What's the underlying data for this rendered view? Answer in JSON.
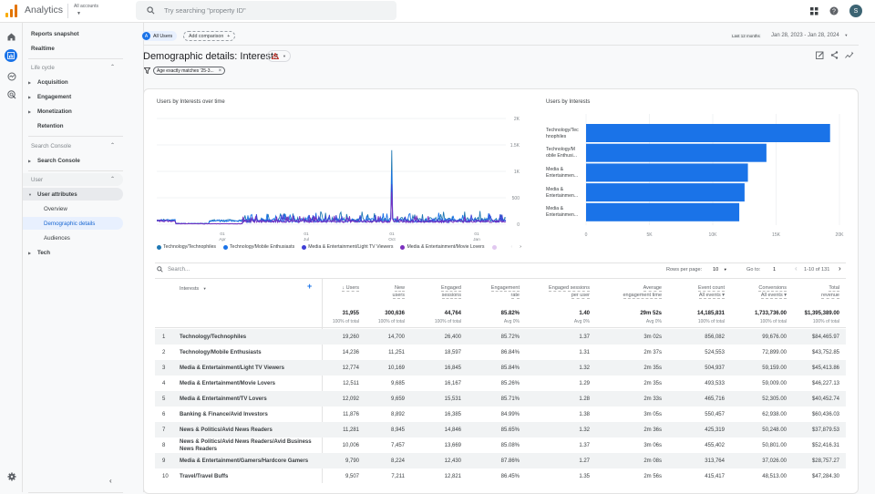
{
  "app": {
    "title": "Analytics",
    "accounts_label": "All accounts",
    "search_placeholder": "Try searching \"property ID\"",
    "avatar_initial": "S"
  },
  "nav": {
    "items": [
      {
        "label": "Reports snapshot",
        "type": "link"
      },
      {
        "label": "Realtime",
        "type": "link"
      },
      {
        "label": "Life cycle",
        "type": "section"
      },
      {
        "label": "Acquisition",
        "type": "group"
      },
      {
        "label": "Engagement",
        "type": "group"
      },
      {
        "label": "Monetization",
        "type": "group"
      },
      {
        "label": "Retention",
        "type": "link"
      },
      {
        "label": "Search Console",
        "type": "section"
      },
      {
        "label": "Search Console",
        "type": "group"
      },
      {
        "label": "User",
        "type": "section"
      },
      {
        "label": "User attributes",
        "type": "group-open"
      },
      {
        "label": "Overview",
        "type": "sub"
      },
      {
        "label": "Demographic details",
        "type": "sub-selected"
      },
      {
        "label": "Audiences",
        "type": "sub"
      },
      {
        "label": "Tech",
        "type": "group"
      }
    ]
  },
  "header": {
    "segment_letter": "A",
    "segment": "All Users",
    "add_comparison": "Add comparison",
    "date_label": "Last 12 months",
    "date_range": "Jan 28, 2023 - Jan 28, 2024",
    "title": "Demographic details: Interests",
    "filter": "Age exactly matches '25-3..."
  },
  "chart_data": [
    {
      "type": "line",
      "title": "Users by Interests over time",
      "x_ticks": [
        "01 Apr",
        "01 Jul",
        "01 Oct",
        "01 Jan"
      ],
      "y_ticks": [
        "0",
        "500",
        "1K",
        "1.5K",
        "2K"
      ],
      "ylim": [
        0,
        2000
      ],
      "series": [
        {
          "name": "Technology/Technophiles",
          "color": "#1f78b4",
          "peak": 1400
        },
        {
          "name": "Technology/Mobile Enthusiasts",
          "color": "#1a73e8",
          "peak": 1100
        },
        {
          "name": "Media & Entertainment/Light TV Viewers",
          "color": "#3f3fd6",
          "peak": 900
        },
        {
          "name": "Media & Entertainment/Movie Lovers",
          "color": "#7b2fbe",
          "peak": 800
        }
      ]
    },
    {
      "type": "bar",
      "title": "Users by Interests",
      "categories": [
        "Technology/Technophiles",
        "Technology/Mobile Enthusiasts",
        "Media & Entertainment/Light TV Viewers",
        "Media & Entertainment/Movie Lovers",
        "Media & Entertainment/TV Lovers"
      ],
      "labels": [
        "Technology/Tec hnophiles",
        "Technology/M obile Enthusi...",
        "Media & Entertainmen...",
        "Media & Entertainmen...",
        "Media & Entertainmen..."
      ],
      "values": [
        19260,
        14236,
        12774,
        12511,
        12092
      ],
      "x_ticks": [
        "0",
        "5K",
        "10K",
        "15K",
        "20K"
      ],
      "xlim": [
        0,
        20000
      ],
      "color": "#1a73e8"
    }
  ],
  "table": {
    "search_placeholder": "Search...",
    "rows_per_page_label": "Rows per page:",
    "rows_per_page": "10",
    "goto_label": "Go to:",
    "goto": "1",
    "range": "1-10 of 131",
    "dimension": "Interests",
    "columns": [
      {
        "l1": "↓ Users",
        "l2": ""
      },
      {
        "l1": "New",
        "l2": "users"
      },
      {
        "l1": "Engaged",
        "l2": "sessions"
      },
      {
        "l1": "Engagement",
        "l2": "rate"
      },
      {
        "l1": "Engaged sessions",
        "l2": "per user"
      },
      {
        "l1": "Average",
        "l2": "engagement time"
      },
      {
        "l1": "Event count",
        "l2": "All events ▾"
      },
      {
        "l1": "Conversions",
        "l2": "All events ▾"
      },
      {
        "l1": "Total",
        "l2": "revenue"
      }
    ],
    "totals": [
      {
        "v": "31,955",
        "s": "100% of total"
      },
      {
        "v": "300,636",
        "s": "100% of total"
      },
      {
        "v": "44,764",
        "s": "100% of total"
      },
      {
        "v": "85.82%",
        "s": "Avg 0%"
      },
      {
        "v": "1.40",
        "s": "Avg 0%"
      },
      {
        "v": "29m 52s",
        "s": "Avg 0%"
      },
      {
        "v": "14,185,831",
        "s": "100% of total"
      },
      {
        "v": "1,733,736.00",
        "s": "100% of total"
      },
      {
        "v": "$1,395,389.00",
        "s": "100% of total"
      }
    ],
    "rows": [
      [
        "1",
        "Technology/Technophiles",
        "19,260",
        "14,700",
        "26,400",
        "85.72%",
        "1.37",
        "3m 02s",
        "856,082",
        "99,676.00",
        "$84,465.97"
      ],
      [
        "2",
        "Technology/Mobile Enthusiasts",
        "14,236",
        "11,251",
        "18,597",
        "86.84%",
        "1.31",
        "2m 37s",
        "524,553",
        "72,899.00",
        "$43,752.85"
      ],
      [
        "3",
        "Media & Entertainment/Light TV Viewers",
        "12,774",
        "10,169",
        "16,845",
        "85.84%",
        "1.32",
        "2m 35s",
        "504,937",
        "59,159.00",
        "$45,413.86"
      ],
      [
        "4",
        "Media & Entertainment/Movie Lovers",
        "12,511",
        "9,685",
        "16,167",
        "85.26%",
        "1.29",
        "2m 35s",
        "493,533",
        "59,009.00",
        "$46,227.13"
      ],
      [
        "5",
        "Media & Entertainment/TV Lovers",
        "12,092",
        "9,659",
        "15,531",
        "85.71%",
        "1.28",
        "2m 33s",
        "465,716",
        "52,305.00",
        "$40,452.74"
      ],
      [
        "6",
        "Banking & Finance/Avid Investors",
        "11,876",
        "8,892",
        "16,385",
        "84.99%",
        "1.38",
        "3m 05s",
        "550,457",
        "62,938.00",
        "$60,436.03"
      ],
      [
        "7",
        "News & Politics/Avid News Readers",
        "11,281",
        "8,945",
        "14,846",
        "85.65%",
        "1.32",
        "2m 36s",
        "425,319",
        "50,248.00",
        "$37,879.53"
      ],
      [
        "8",
        "News & Politics/Avid News Readers/Avid Business News Readers",
        "10,006",
        "7,457",
        "13,669",
        "85.08%",
        "1.37",
        "3m 06s",
        "455,402",
        "50,801.00",
        "$52,416.31"
      ],
      [
        "9",
        "Media & Entertainment/Gamers/Hardcore Gamers",
        "9,790",
        "8,224",
        "12,430",
        "87.86%",
        "1.27",
        "2m 08s",
        "313,764",
        "37,026.00",
        "$28,757.27"
      ],
      [
        "10",
        "Travel/Travel Buffs",
        "9,507",
        "7,211",
        "12,821",
        "86.45%",
        "1.35",
        "2m 56s",
        "415,417",
        "48,513.00",
        "$47,284.30"
      ]
    ]
  }
}
